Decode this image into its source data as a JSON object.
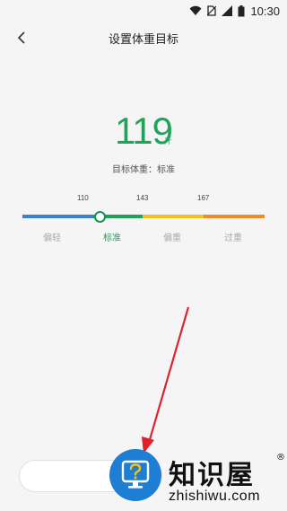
{
  "status_bar": {
    "time": "10:30",
    "icons": [
      "wifi-icon",
      "no-sim-icon",
      "signal-icon",
      "battery-icon"
    ]
  },
  "header": {
    "title": "设置体重目标",
    "back_icon": "chevron-left-icon"
  },
  "weight": {
    "value": "119",
    "unit": "斤",
    "goal_text": "目标体重：标准"
  },
  "scale": {
    "ticks": [
      "110",
      "143",
      "167"
    ],
    "categories": [
      "偏轻",
      "标准",
      "偏重",
      "过重"
    ],
    "active_category": "标准",
    "knob_position_fraction": 0.32,
    "colors": {
      "underweight": "#3a7fd0",
      "normal": "#1fa158",
      "overweight": "#f0c020",
      "obese": "#f08a24"
    }
  },
  "input": {
    "value": ""
  },
  "watermark": {
    "title": "知识屋",
    "registered": "®",
    "domain": "zhishiwu.com",
    "icon": "help-monitor-icon",
    "icon_color": "#1e7ed4"
  },
  "annotation": {
    "arrow_color": "#e0202a"
  }
}
